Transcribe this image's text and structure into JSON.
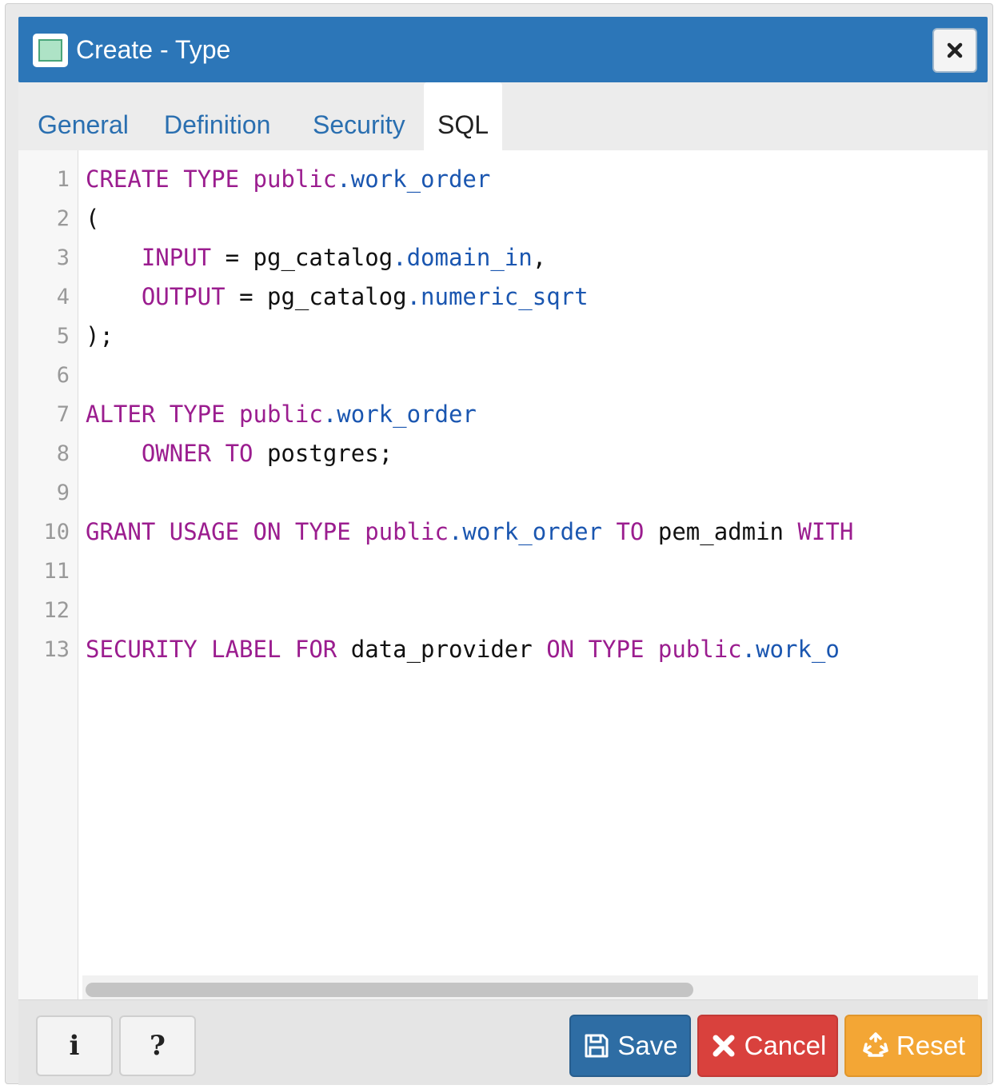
{
  "dialog": {
    "title": "Create - Type",
    "title_icon": "type-icon",
    "close_icon": "close-icon"
  },
  "tabs": [
    {
      "label": "General",
      "active": false
    },
    {
      "label": "Definition",
      "active": false
    },
    {
      "label": "Security",
      "active": false
    },
    {
      "label": "SQL",
      "active": true
    }
  ],
  "editor": {
    "line_numbers": [
      "1",
      "2",
      "3",
      "4",
      "5",
      "6",
      "7",
      "8",
      "9",
      "10",
      "11",
      "12",
      "13"
    ],
    "lines": [
      [
        {
          "t": "CREATE TYPE public",
          "c": "kw"
        },
        {
          "t": ".work_order",
          "c": "fn"
        }
      ],
      [
        {
          "t": "(",
          "c": "tx"
        }
      ],
      [
        {
          "t": "    INPUT",
          "c": "kw"
        },
        {
          "t": " = pg_catalog",
          "c": "tx"
        },
        {
          "t": ".domain_in",
          "c": "fn"
        },
        {
          "t": ",",
          "c": "tx"
        }
      ],
      [
        {
          "t": "    OUTPUT",
          "c": "kw"
        },
        {
          "t": " = pg_catalog",
          "c": "tx"
        },
        {
          "t": ".numeric_sqrt",
          "c": "fn"
        }
      ],
      [
        {
          "t": ");",
          "c": "tx"
        }
      ],
      [],
      [
        {
          "t": "ALTER TYPE public",
          "c": "kw"
        },
        {
          "t": ".work_order",
          "c": "fn"
        }
      ],
      [
        {
          "t": "    OWNER TO",
          "c": "kw"
        },
        {
          "t": " postgres;",
          "c": "tx"
        }
      ],
      [],
      [
        {
          "t": "GRANT USAGE ON TYPE public",
          "c": "kw"
        },
        {
          "t": ".work_order",
          "c": "fn"
        },
        {
          "t": " TO",
          "c": "kw"
        },
        {
          "t": " pem_admin ",
          "c": "tx"
        },
        {
          "t": "WITH",
          "c": "kw"
        }
      ],
      [],
      [],
      [
        {
          "t": "SECURITY LABEL FOR",
          "c": "kw"
        },
        {
          "t": " data_provider ",
          "c": "tx"
        },
        {
          "t": "ON TYPE public",
          "c": "kw"
        },
        {
          "t": ".work_o",
          "c": "fn"
        }
      ]
    ]
  },
  "footer": {
    "info_label": "i",
    "help_label": "?",
    "save_label": "Save",
    "save_icon": "floppy-disk-icon",
    "cancel_label": "Cancel",
    "cancel_icon": "x-icon",
    "reset_label": "Reset",
    "reset_icon": "recycle-icon"
  },
  "colors": {
    "titlebar": "#2c76b8",
    "keyword": "#9b1d8f",
    "identifier": "#1a56b0",
    "save": "#2e6da4",
    "cancel": "#d9413d",
    "reset": "#f3a635"
  }
}
